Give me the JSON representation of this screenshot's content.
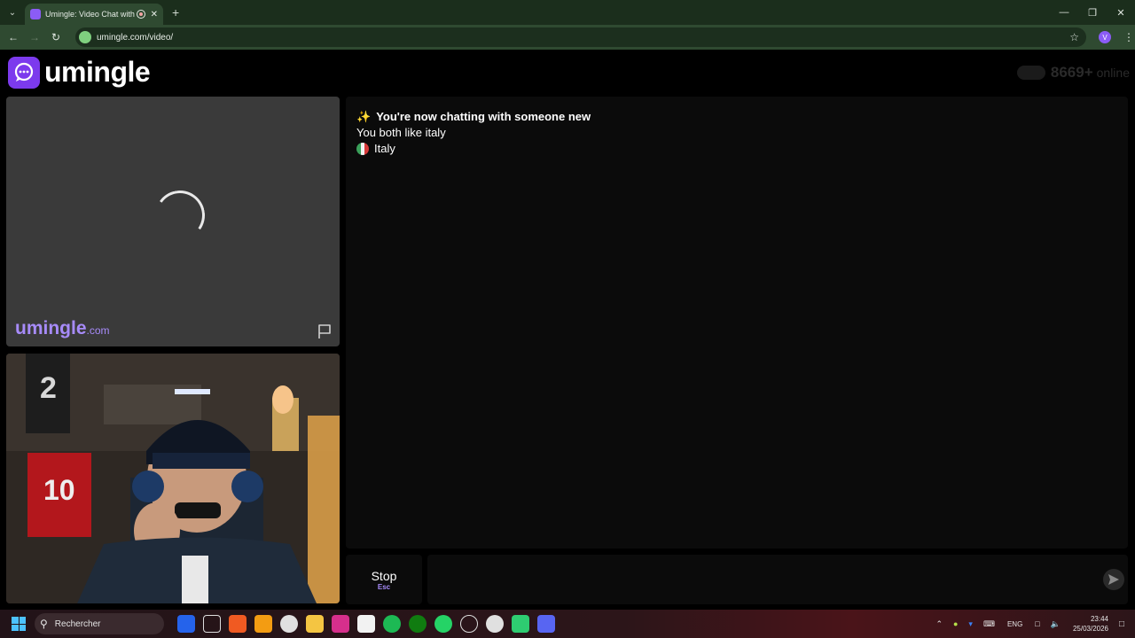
{
  "browser": {
    "tab_title": "Umingle: Video Chat with S",
    "url": "umingle.com/video/",
    "profile_initial": "V"
  },
  "site": {
    "logo_text": "umingle",
    "online_count": "8669+",
    "online_label": "online",
    "watermark_name": "umingle",
    "watermark_suffix": ".com"
  },
  "chat": {
    "messages": [
      {
        "icon": "sparkles",
        "text": "You're now chatting with someone new"
      },
      {
        "text": "You both like italy"
      },
      {
        "icon": "italy-flag",
        "text": "Italy"
      }
    ]
  },
  "controls": {
    "stop_label": "Stop",
    "stop_key": "Esc"
  },
  "taskbar": {
    "search_label": "Rechercher",
    "lang": "ENG",
    "time": "23:44",
    "date": "25/03/2026"
  },
  "colors": {
    "brand_purple": "#7c3aed",
    "brand_light": "#a78bfa",
    "chrome_green": "#2f4a31"
  }
}
